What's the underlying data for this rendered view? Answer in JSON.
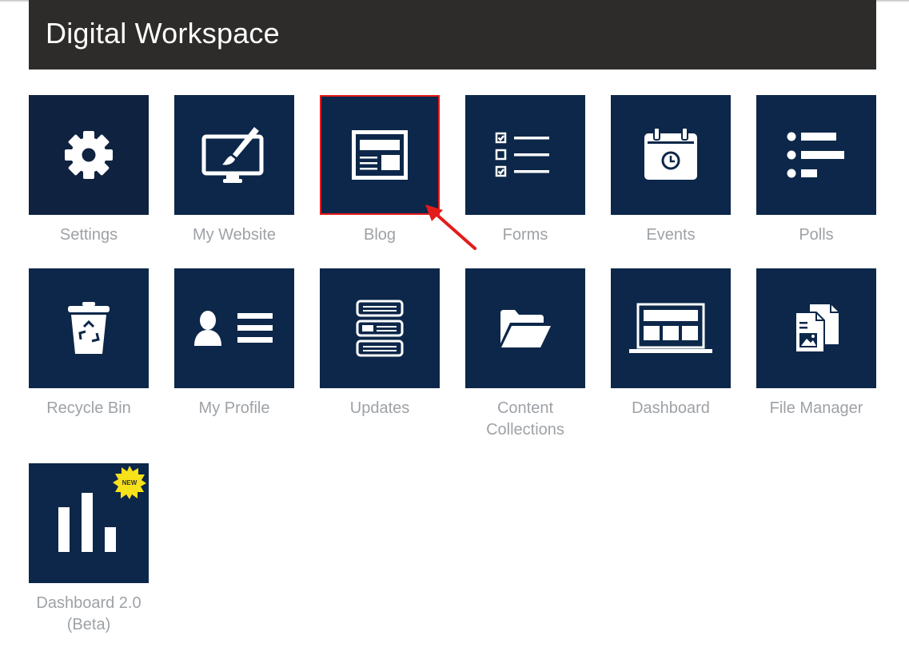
{
  "header": {
    "title": "Digital Workspace"
  },
  "tiles": [
    {
      "label": "Settings",
      "icon": "gear-icon"
    },
    {
      "label": "My Website",
      "icon": "monitor-brush-icon"
    },
    {
      "label": "Blog",
      "icon": "blog-layout-icon",
      "selected": true
    },
    {
      "label": "Forms",
      "icon": "checklist-icon"
    },
    {
      "label": "Events",
      "icon": "calendar-clock-icon"
    },
    {
      "label": "Polls",
      "icon": "poll-bars-icon"
    },
    {
      "label": "Recycle Bin",
      "icon": "recycle-bin-icon"
    },
    {
      "label": "My Profile",
      "icon": "profile-card-icon"
    },
    {
      "label": "Updates",
      "icon": "updates-list-icon"
    },
    {
      "label_line1": "Content",
      "label_line2": "Collections",
      "icon": "folder-open-icon"
    },
    {
      "label": "Dashboard",
      "icon": "dashboard-laptop-icon"
    },
    {
      "label": "File Manager",
      "icon": "files-icon"
    },
    {
      "label_line1": "Dashboard 2.0",
      "label_line2": "(Beta)",
      "icon": "bar-chart-icon",
      "badge": "NEW"
    }
  ],
  "colors": {
    "header_bg": "#2d2c2b",
    "tile_bg": "#0c2749",
    "label": "#9ea2a6",
    "highlight": "#e41b1b",
    "badge": "#f7e11a"
  }
}
